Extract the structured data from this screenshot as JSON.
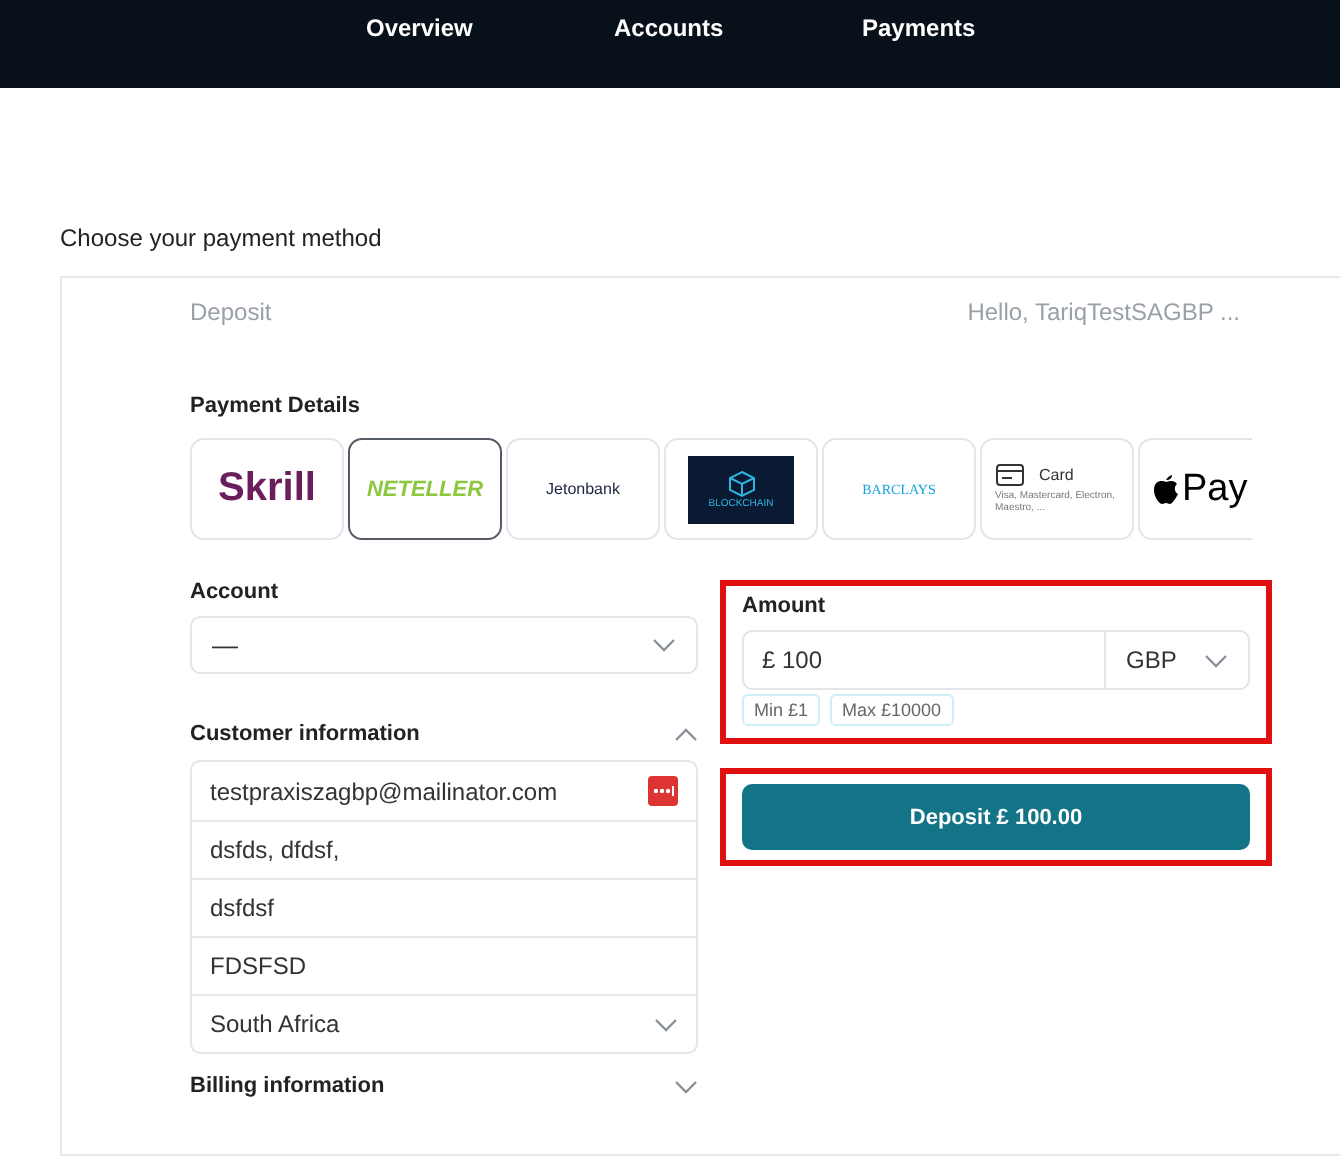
{
  "nav": [
    {
      "label": "Overview"
    },
    {
      "label": "Accounts"
    },
    {
      "label": "Payments"
    }
  ],
  "heading": "Choose your payment method",
  "card": {
    "title": "Deposit",
    "greeting": "Hello, TariqTestSAGBP ...",
    "payment_details": "Payment Details",
    "methods": [
      {
        "kind": "skrill",
        "label": "Skrill",
        "selected": false
      },
      {
        "kind": "neteller",
        "label": "NETELLER",
        "selected": true
      },
      {
        "kind": "jeton",
        "label": "Jetonbank",
        "selected": false
      },
      {
        "kind": "blockchain",
        "label": "BLOCKCHAIN",
        "selected": false
      },
      {
        "kind": "barclays",
        "label": "BARCLAYS",
        "selected": false
      },
      {
        "kind": "card",
        "label": "Card",
        "sub": "Visa, Mastercard, Electron, Maestro, ...",
        "selected": false
      },
      {
        "kind": "apple",
        "label": "Pay",
        "selected": false
      }
    ],
    "account": {
      "label": "Account",
      "value": "—"
    },
    "customer": {
      "label": "Customer information",
      "expanded": true,
      "fields": [
        {
          "kind": "email",
          "value": "testpraxiszagbp@mailinator.com"
        },
        {
          "kind": "text",
          "value": "dsfds, dfdsf,"
        },
        {
          "kind": "text",
          "value": "dsfdsf"
        },
        {
          "kind": "text",
          "value": "FDSFSD"
        },
        {
          "kind": "select",
          "value": "South Africa"
        }
      ]
    },
    "billing": {
      "label": "Billing information",
      "expanded": false
    },
    "amount": {
      "label": "Amount",
      "value": "£ 100",
      "currency": "GBP",
      "limits": [
        "Min £1",
        "Max £10000"
      ],
      "highlighted": true
    },
    "deposit_button": {
      "label": "Deposit £ 100.00",
      "highlighted": true
    }
  }
}
